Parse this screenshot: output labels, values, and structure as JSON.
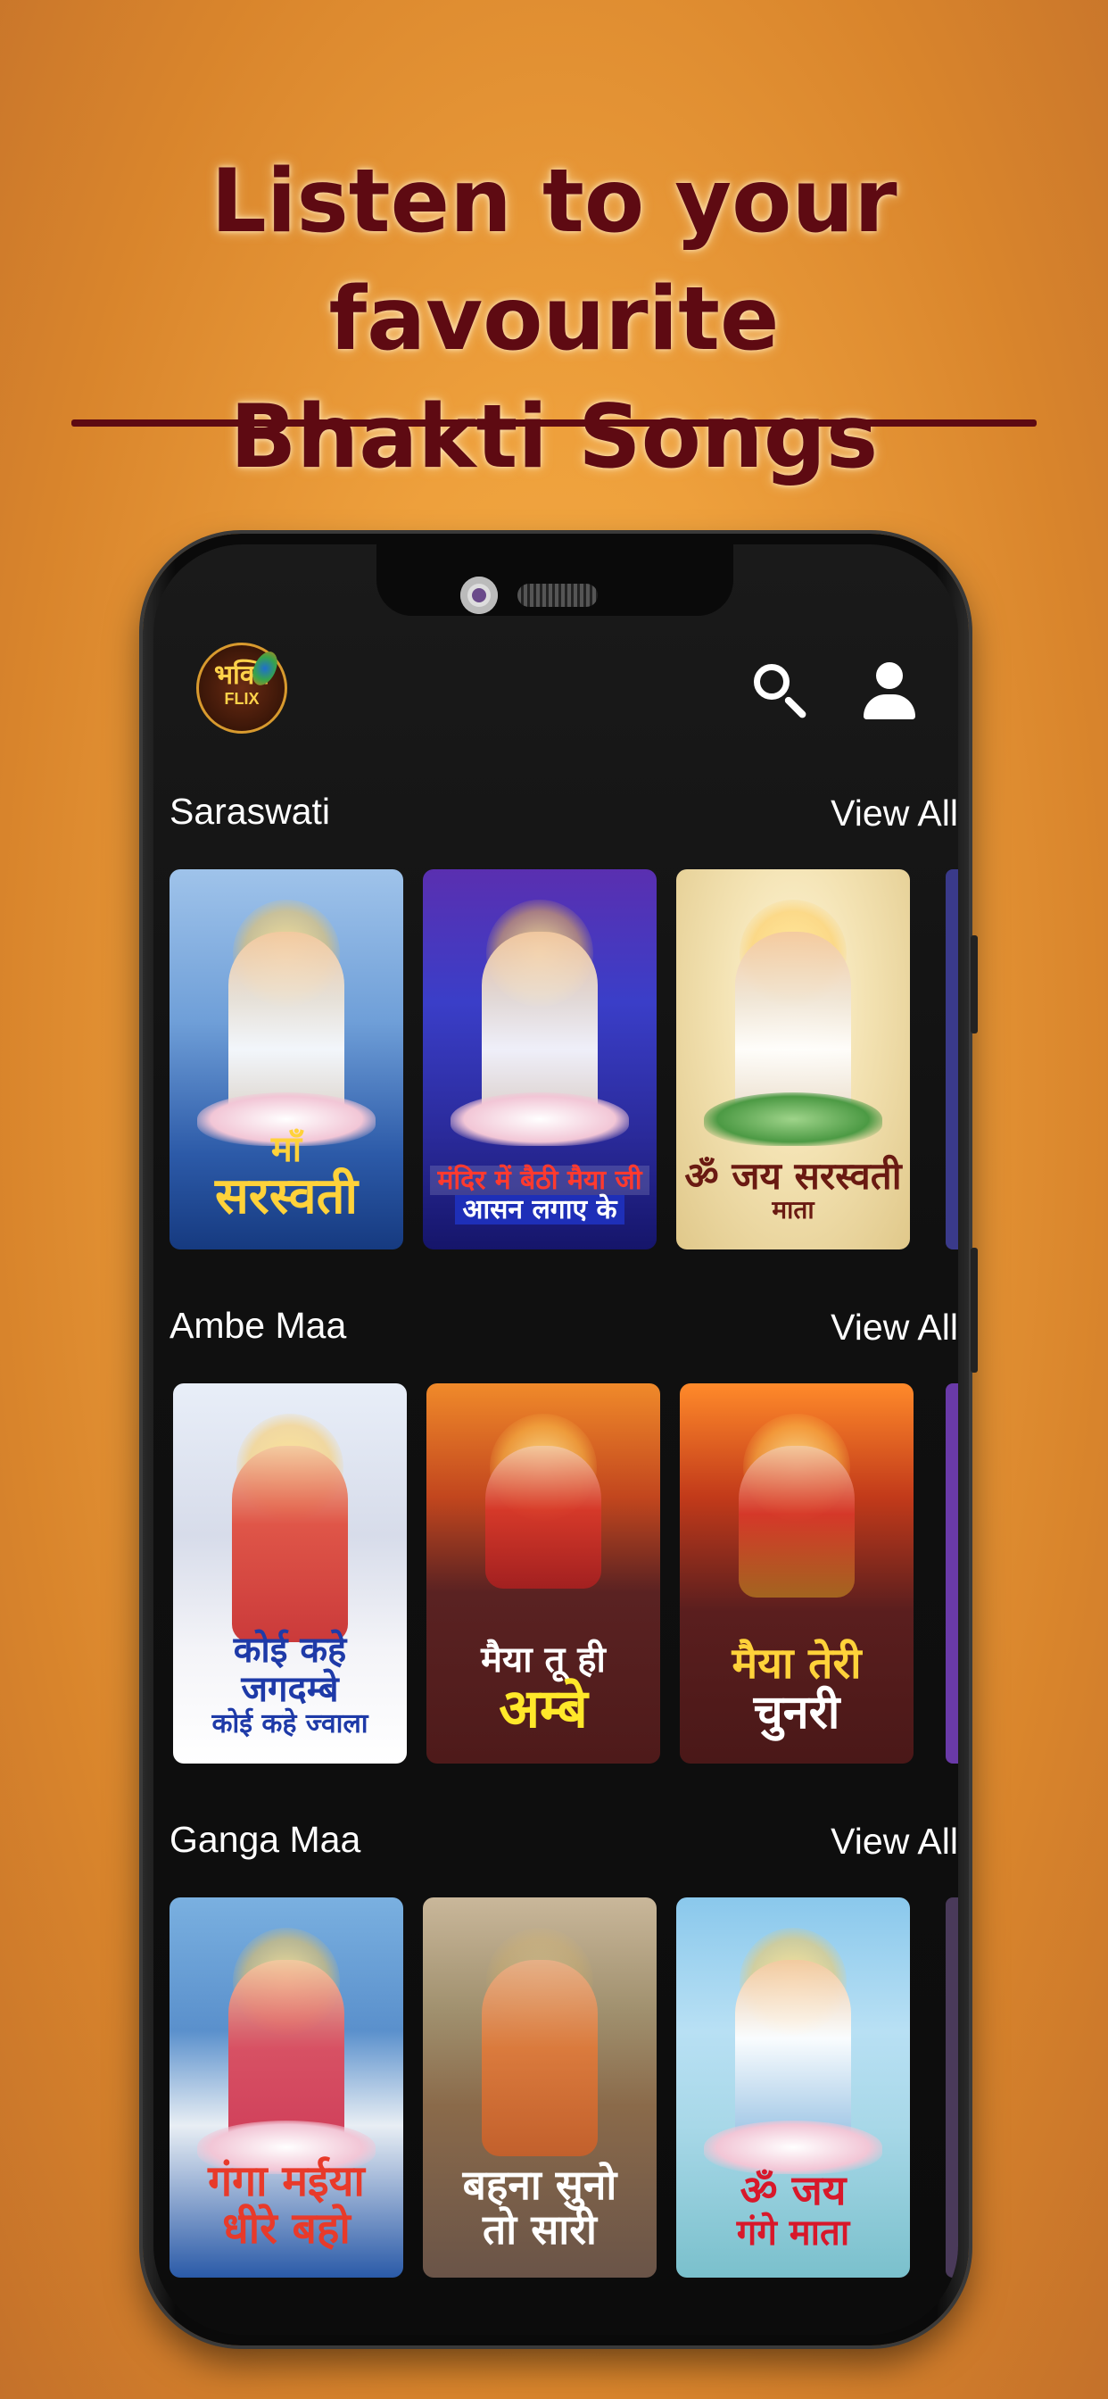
{
  "headline": {
    "line1": "Listen to your favourite",
    "line2": "Bhakti Songs"
  },
  "app": {
    "logo": {
      "top": "भक्ति",
      "bottom": "FLIX"
    },
    "icons": {
      "search": "search-icon",
      "profile": "profile-icon"
    }
  },
  "sections": [
    {
      "title": "Saraswati",
      "view_all": "View All",
      "cards": [
        {
          "cap1": "माँ",
          "cap2": "सरस्वती"
        },
        {
          "cap1": "मंदिर में बैठी मैया जी",
          "cap2": "आसन लगाए के"
        },
        {
          "cap1": "ॐ जय सरस्वती",
          "cap2": "माता"
        }
      ]
    },
    {
      "title": "Ambe Maa",
      "view_all": "View All",
      "cards": [
        {
          "cap1": "कोई कहे जगदम्बे",
          "cap2": "कोई कहे ज्वाला"
        },
        {
          "cap1": "मैया तू ही",
          "cap2": "अम्बे"
        },
        {
          "cap1": "मैया तेरी",
          "cap2": "चुनरी"
        }
      ]
    },
    {
      "title": "Ganga Maa",
      "view_all": "View All",
      "cards": [
        {
          "cap1": "गंगा मईया",
          "cap2": "धीरे बहो"
        },
        {
          "cap1": "बहना सुनो",
          "cap2": "तो सारी"
        },
        {
          "cap1": "ॐ जय",
          "cap2": "गंगे माता"
        }
      ]
    }
  ],
  "colors": {
    "headline": "#5e0a12",
    "background": "#eea03c",
    "screen": "#0c0c0c"
  }
}
